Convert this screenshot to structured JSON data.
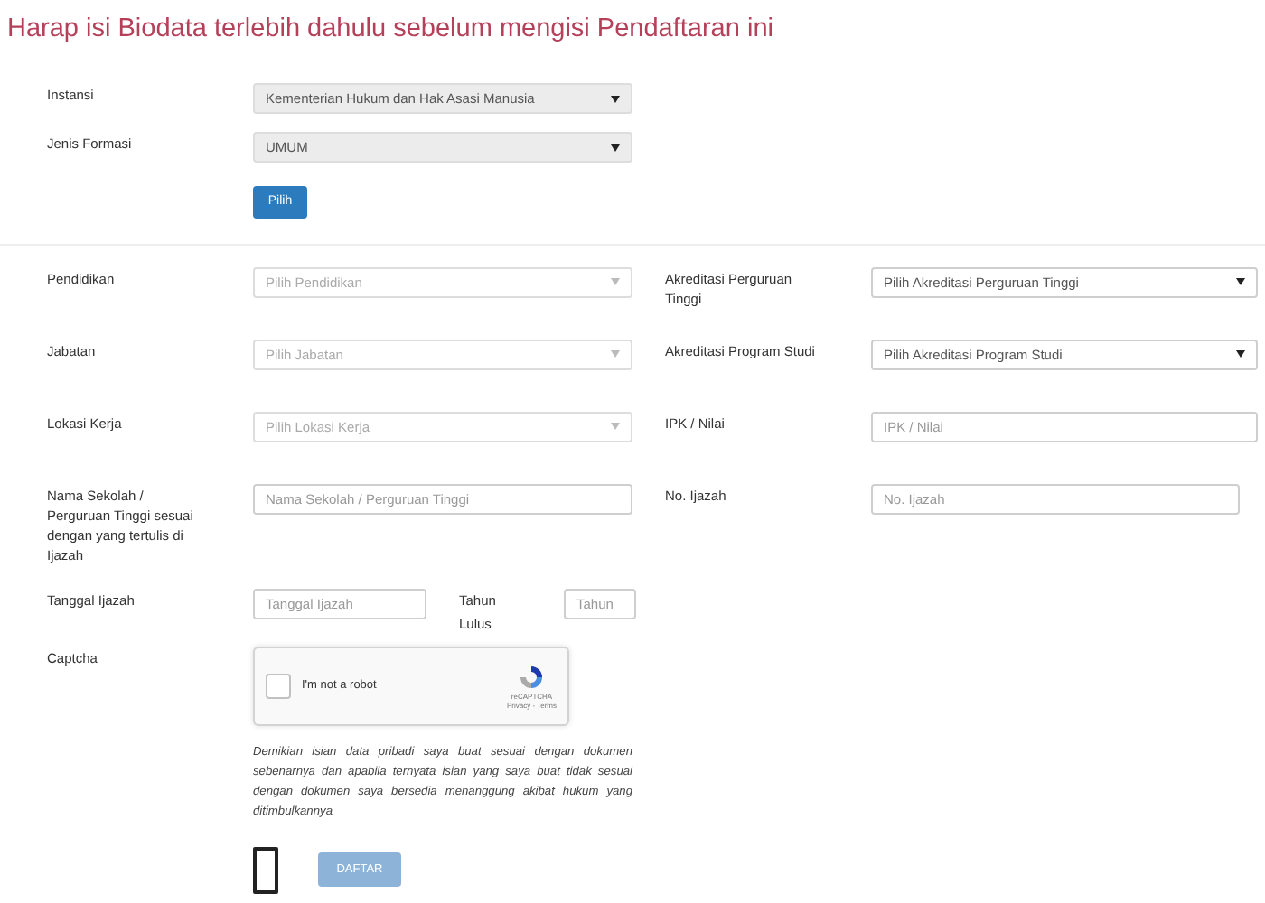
{
  "title": "Harap isi Biodata terlebih dahulu sebelum mengisi Pendaftaran ini",
  "top_fields": [
    {
      "label": "Instansi",
      "value": "Kementerian Hukum dan Hak Asasi Manusia"
    },
    {
      "label": "Jenis Formasi",
      "value": "UMUM"
    }
  ],
  "pilih_button": "Pilih",
  "rows": [
    {
      "left": {
        "label": "Pendidikan",
        "kind": "select",
        "value": "Pilih Pendidikan",
        "disabled": true
      },
      "right": {
        "label": "Akreditasi Perguruan Tinggi",
        "kind": "select",
        "value": "Pilih Akreditasi Perguruan Tinggi",
        "disabled": false
      }
    },
    {
      "left": {
        "label": "Jabatan",
        "kind": "select",
        "value": "Pilih Jabatan",
        "disabled": true
      },
      "right": {
        "label": "Akreditasi Program Studi",
        "kind": "select",
        "value": "Pilih Akreditasi Program Studi",
        "disabled": false
      }
    },
    {
      "left": {
        "label": "Lokasi Kerja",
        "kind": "select",
        "value": "Pilih Lokasi Kerja",
        "disabled": true
      },
      "right": {
        "label": "IPK / Nilai",
        "kind": "input",
        "placeholder": "IPK / Nilai"
      }
    },
    {
      "left": {
        "label": "Nama Sekolah / Perguruan Tinggi sesuai dengan yang tertulis di Ijazah",
        "kind": "input",
        "placeholder": "Nama Sekolah / Perguruan Tinggi"
      },
      "right": {
        "label": "No. Ijazah",
        "kind": "input",
        "placeholder": "No. Ijazah"
      }
    }
  ],
  "tanggal": {
    "label": "Tanggal Ijazah",
    "placeholder": "Tanggal Ijazah"
  },
  "tahun": {
    "label": "Tahun Lulus",
    "placeholder": "Tahun"
  },
  "captcha": {
    "label": "Captcha",
    "checkbox_label": "I'm not a robot",
    "checked": false,
    "brand": "reCAPTCHA",
    "links": "Privacy - Terms"
  },
  "statement": "Demikian isian data pribadi saya buat sesuai dengan dokumen sebenarnya dan apabila ternyata isian yang saya buat tidak sesuai dengan dokumen saya bersedia menanggung akibat hukum yang ditimbulkannya",
  "agree": {
    "checked": false
  },
  "submit": {
    "label": "DAFTAR",
    "disabled": true
  }
}
